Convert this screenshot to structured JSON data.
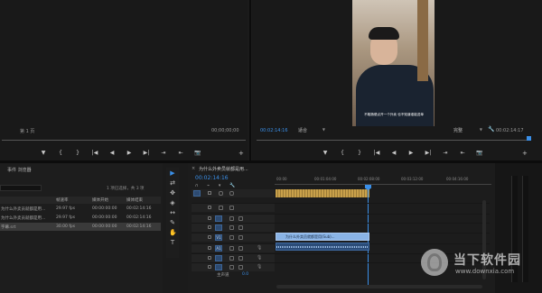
{
  "source_monitor": {
    "page_label": "第 1 页",
    "timecode_right": "00;00;00;00"
  },
  "program_monitor": {
    "timecode_left": "00:02:14:16",
    "fit_label": "适合",
    "quality_label": "完整",
    "timecode_right": "00:02:14:17",
    "subtitle_text": "不敢随便点开一个外卖 也不知道谁能送单"
  },
  "transport": {
    "left": [
      "▼",
      "{",
      "}",
      "|◀",
      "◀",
      "▶",
      "▶|",
      "⇥",
      "⇤",
      "📷",
      "+"
    ],
    "right": [
      "▼",
      "{",
      "}",
      "|◀",
      "◀",
      "▶",
      "▶|",
      "⇥",
      "⇤",
      "📷",
      "+"
    ]
  },
  "project": {
    "title": "事件 浏览器",
    "selection_info": "1 项已选择，共 3 项",
    "columns": [
      "帧速率",
      "媒体开始",
      "媒体结束"
    ],
    "rows": [
      {
        "name": "为什么外卖员就都是用...",
        "fps": "29.97 fps",
        "start": "00:00:00:00",
        "end": "00:02:14:16"
      },
      {
        "name": "为什么外卖员就都是用...",
        "fps": "29.97 fps",
        "start": "00:00:00:00",
        "end": "00:02:14:16"
      },
      {
        "name": "字幕.srt",
        "fps": "30.00 fps",
        "start": "00:00:00:00",
        "end": "00:02:14:16"
      }
    ]
  },
  "tools": [
    "▶",
    "⇄",
    "✥",
    "◈",
    "↔",
    "✎",
    "✋",
    "T"
  ],
  "timeline": {
    "tab_title": "为什么外卖员就都是用...",
    "playhead_time": "00:02:14:16",
    "ruler_labels": [
      "00:00",
      "00:01:04:00",
      "00:02:08:00",
      "00:03:12:00",
      "00:04:16:00"
    ],
    "video_clip_label": "为什么外卖员就都是用(Sub)...",
    "track_labels": {
      "v": "V1",
      "a": "A1"
    },
    "master_label": "主声道",
    "master_value": "0.0"
  },
  "watermark": {
    "brand": "当下软件园",
    "url": "www.downxia.com"
  },
  "colors": {
    "accent_blue": "#3a8fe8",
    "clip_blue": "#8ab4e6",
    "audio_clip": "#2b4c78",
    "panel_bg": "#1f1f1f"
  }
}
